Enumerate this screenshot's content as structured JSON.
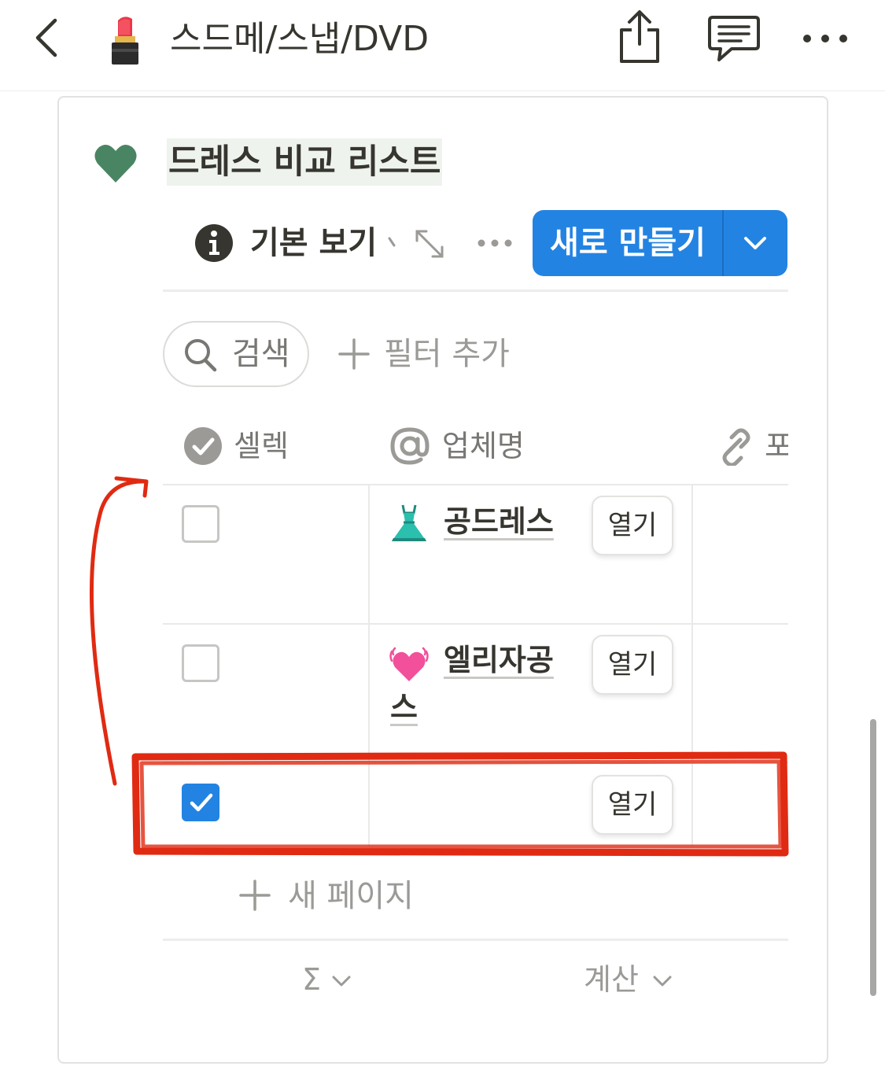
{
  "topbar": {
    "page_title": "스드메/스냅/DVD",
    "page_icon": "lipstick-icon",
    "actions": [
      "back-icon",
      "share-icon",
      "comment-icon",
      "more-icon"
    ]
  },
  "database": {
    "icon": "green-heart-icon",
    "icon_color": "#4a8563",
    "title": "드레스 비교 리스트",
    "view": {
      "label": "기본 보기",
      "icon": "info-icon"
    },
    "new_button": {
      "label": "새로 만들기",
      "color": "#2383e2"
    },
    "search": {
      "label": "검색"
    },
    "filter": {
      "label": "필터 추가"
    },
    "columns": [
      {
        "label": "셀렉",
        "icon": "checkbox-circle-icon"
      },
      {
        "label": "업체명",
        "icon": "at-sign-icon"
      },
      {
        "label": "포",
        "icon": "link-icon"
      }
    ],
    "rows": [
      {
        "checked": false,
        "emoji": "dress-icon",
        "name_line1": "공드레스",
        "name_line2": "",
        "open_label": "열기"
      },
      {
        "checked": false,
        "emoji": "beating-heart-icon",
        "name_line1": "엘리자공",
        "name_line2": "스",
        "open_label": "열기"
      },
      {
        "checked": true,
        "emoji": "",
        "name_line1": "",
        "name_line2": "",
        "open_label": "열기"
      }
    ],
    "new_page": {
      "label": "새 페이지"
    },
    "footer": {
      "sum_symbol": "Σ",
      "calc_label": "계산"
    }
  },
  "annotation": {
    "color": "#e02a12",
    "shape": "rectangle-around-row-3-with-arrow-up"
  }
}
